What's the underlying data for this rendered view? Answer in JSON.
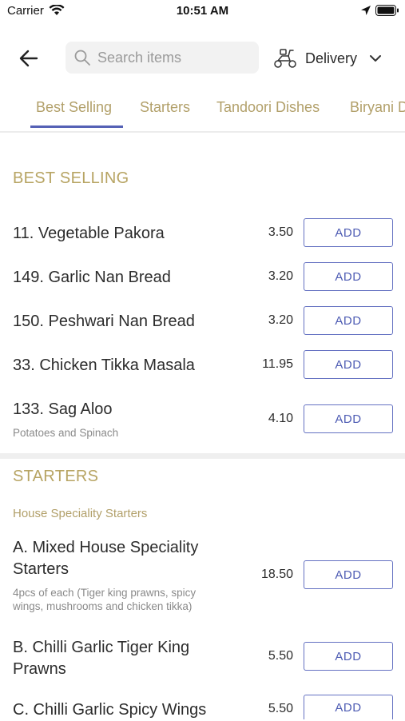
{
  "status_bar": {
    "carrier": "Carrier",
    "time": "10:51 AM"
  },
  "header": {
    "search_placeholder": "Search items",
    "delivery_label": "Delivery"
  },
  "tabs": [
    "Best Selling",
    "Starters",
    "Tandoori Dishes",
    "Biryani D"
  ],
  "active_tab": "Best Selling",
  "sections": {
    "best_selling": {
      "title": "BEST SELLING",
      "items": [
        {
          "name": "11. Vegetable Pakora",
          "price": "3.50",
          "button": "ADD"
        },
        {
          "name": "149. Garlic Nan Bread",
          "price": "3.20",
          "button": "ADD"
        },
        {
          "name": "150. Peshwari Nan Bread",
          "price": "3.20",
          "button": "ADD"
        },
        {
          "name": "33. Chicken Tikka Masala",
          "price": "11.95",
          "button": "ADD"
        },
        {
          "name": "133. Sag Aloo",
          "description": "Potatoes and Spinach",
          "price": "4.10",
          "button": "ADD"
        }
      ]
    },
    "starters": {
      "title": "STARTERS",
      "subsection": "House Speciality Starters",
      "items": [
        {
          "name_line1": "A. Mixed House Speciality",
          "name_line2": "Starters",
          "description_line1": "4pcs of each (Tiger king prawns, spicy",
          "description_line2": "wings, mushrooms and chicken tikka)",
          "price": "18.50",
          "button": "ADD"
        },
        {
          "name_line1": "B. Chilli Garlic Tiger King",
          "name_line2": "Prawns",
          "price": "5.50",
          "button": "ADD"
        },
        {
          "name": "C. Chilli Garlic Spicy Wings",
          "price": "5.50",
          "button": "ADD"
        }
      ]
    }
  },
  "colors": {
    "accent": "#5561b5",
    "section_gold": "#b7a463",
    "tab_gold": "#b2a06a"
  }
}
